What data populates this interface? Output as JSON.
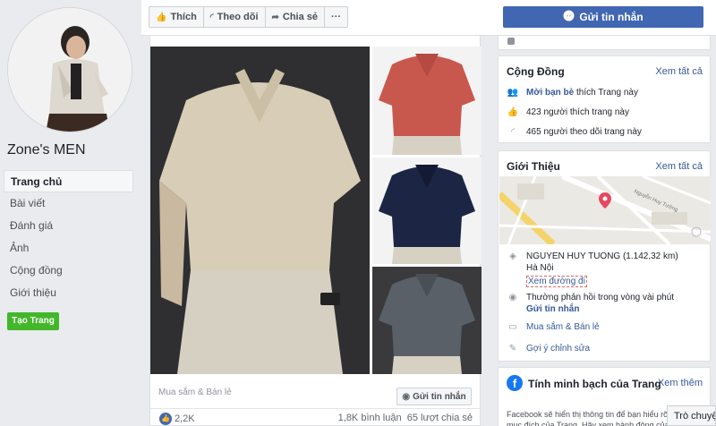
{
  "page": {
    "name": "Zone's MEN"
  },
  "nav": {
    "items": [
      {
        "label": "Trang chủ",
        "active": true
      },
      {
        "label": "Bài viết",
        "active": false
      },
      {
        "label": "Đánh giá",
        "active": false
      },
      {
        "label": "Ảnh",
        "active": false
      },
      {
        "label": "Cộng đồng",
        "active": false
      },
      {
        "label": "Giới thiệu",
        "active": false
      }
    ],
    "create_page": "Tạo Trang"
  },
  "topbar": {
    "like": "Thích",
    "follow": "Theo dõi",
    "share": "Chia sẻ",
    "more": "···",
    "send_message": "Gửi tin nhắn"
  },
  "post": {
    "category": "Mua sắm & Bán lẻ",
    "send_message": "Gửi tin nhắn",
    "likes": "2,2K",
    "comments": "1,8K bình luận",
    "shares": "65 lượt chia sẻ"
  },
  "community": {
    "title": "Cộng Đồng",
    "see_all": "Xem tất cả",
    "invite_pre": "Mời bạn bè",
    "invite_post": " thích Trang này",
    "likes": "423 người thích trang này",
    "follows": "465 người theo dõi trang này"
  },
  "about": {
    "title": "Giới Thiệu",
    "see_all": "Xem tất cả",
    "map_street": "Nguyễn Huy Tưởng",
    "address_line1": "NGUYEN HUY TUONG (1.142,32 km)",
    "address_line2": "Hà Nội",
    "directions": "Xem đường đi",
    "response": "Thường phản hồi trong vòng vài phút",
    "send_message": "Gửi tin nhắn",
    "category": "Mua sắm & Bán lẻ",
    "suggest": "Gợi ý chỉnh sửa"
  },
  "transparency": {
    "title": "Tính minh bạch của Trang",
    "see_more": "Xem thêm",
    "text": "Facebook sẽ hiển thị thông tin để bạn hiểu rõ hơn về mục đích của Trang. Hãy xem hành động của những người quản lý và đăng nội dung."
  },
  "chat": {
    "label": "Trò chuyện"
  },
  "colors": {
    "brand_blue": "#4267b2",
    "link_blue": "#365899",
    "green": "#42b72a",
    "background": "#e9ebee"
  }
}
